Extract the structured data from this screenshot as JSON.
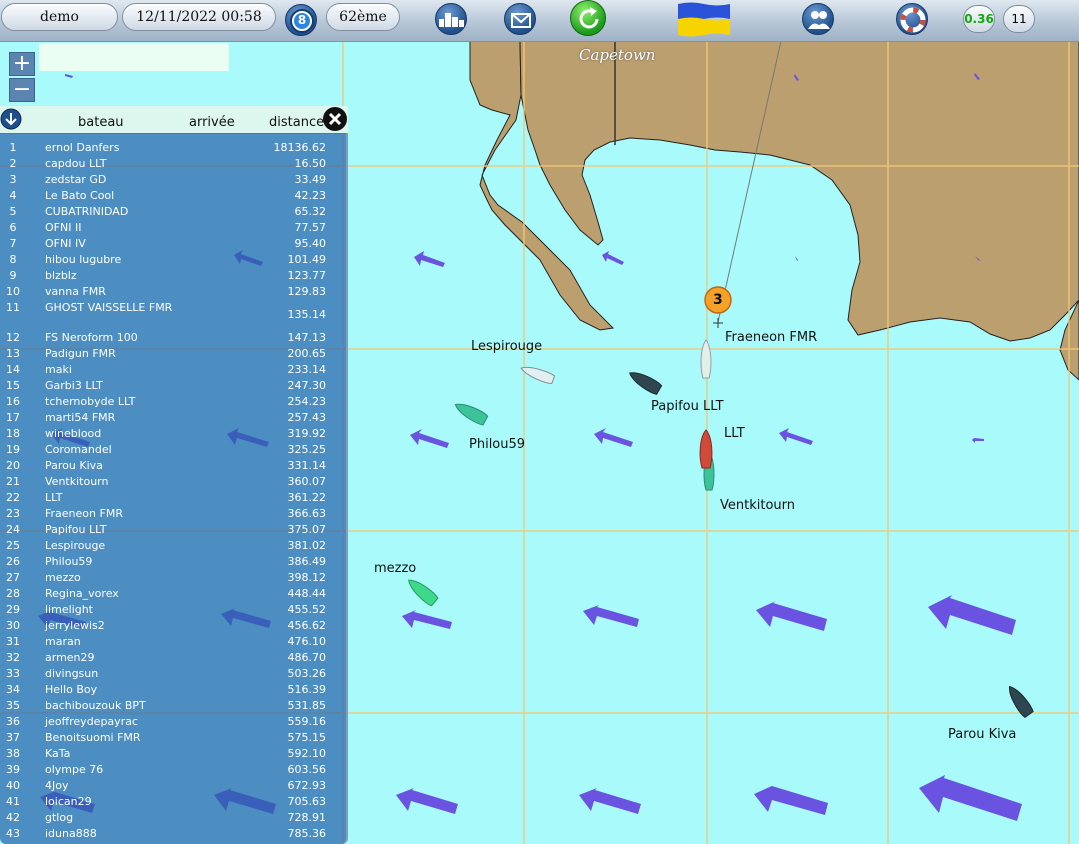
{
  "toolbar": {
    "user": "demo",
    "datetime": "12/11/2022 00:58",
    "clock_badge": "8",
    "rank": "62ème",
    "score_left": "0.36",
    "score_right": "11"
  },
  "map": {
    "city": "Capetown",
    "waypoint_number": "3",
    "boat_labels": [
      "Lespirouge",
      "Fraeneon FMR",
      "Papifou LLT",
      "Philou59",
      "LLT",
      "Ventkitourn",
      "mezzo",
      "Parou Kiva"
    ]
  },
  "ranking": {
    "col_boat": "bateau",
    "col_arrival": "arrivée",
    "col_distance": "distance",
    "rows": [
      {
        "n": "1",
        "name": "ernol Danfers",
        "dist": "18136.62"
      },
      {
        "n": "2",
        "name": "capdou LLT",
        "dist": "16.50"
      },
      {
        "n": "3",
        "name": "zedstar GD",
        "dist": "33.49"
      },
      {
        "n": "4",
        "name": "Le Bato Cool",
        "dist": "42.23"
      },
      {
        "n": "5",
        "name": "CUBATRINIDAD",
        "dist": "65.32"
      },
      {
        "n": "6",
        "name": "OFNI II",
        "dist": "77.57"
      },
      {
        "n": "7",
        "name": "OFNI IV",
        "dist": "95.40"
      },
      {
        "n": "8",
        "name": "hibou lugubre",
        "dist": "101.49"
      },
      {
        "n": "9",
        "name": "blzblz",
        "dist": "123.77"
      },
      {
        "n": "10",
        "name": "vanna FMR",
        "dist": "129.83"
      },
      {
        "n": "11",
        "name": "GHOST VAISSELLE FMR",
        "dist": "135.14"
      },
      {
        "n": "12",
        "name": "FS Neroform 100",
        "dist": "147.13"
      },
      {
        "n": "13",
        "name": "Padigun FMR",
        "dist": "200.65"
      },
      {
        "n": "14",
        "name": "maki",
        "dist": "233.14"
      },
      {
        "n": "15",
        "name": "Garbi3 LLT",
        "dist": "247.30"
      },
      {
        "n": "16",
        "name": "tchernobyde LLT",
        "dist": "254.23"
      },
      {
        "n": "17",
        "name": "marti54 FMR",
        "dist": "257.43"
      },
      {
        "n": "18",
        "name": "wineblood",
        "dist": "319.92"
      },
      {
        "n": "19",
        "name": "Coromandel",
        "dist": "325.25"
      },
      {
        "n": "20",
        "name": "Parou Kiva",
        "dist": "331.14"
      },
      {
        "n": "21",
        "name": "Ventkitourn",
        "dist": "360.07"
      },
      {
        "n": "22",
        "name": "LLT",
        "dist": "361.22"
      },
      {
        "n": "23",
        "name": "Fraeneon FMR",
        "dist": "366.63"
      },
      {
        "n": "24",
        "name": "Papifou LLT",
        "dist": "375.07"
      },
      {
        "n": "25",
        "name": "Lespirouge",
        "dist": "381.02"
      },
      {
        "n": "26",
        "name": "Philou59",
        "dist": "386.49"
      },
      {
        "n": "27",
        "name": "mezzo",
        "dist": "398.12"
      },
      {
        "n": "28",
        "name": "Regina_vorex",
        "dist": "448.44"
      },
      {
        "n": "29",
        "name": "limelight",
        "dist": "455.52"
      },
      {
        "n": "30",
        "name": "jerrylewis2",
        "dist": "456.62"
      },
      {
        "n": "31",
        "name": "maran",
        "dist": "476.10"
      },
      {
        "n": "32",
        "name": "armen29",
        "dist": "486.70"
      },
      {
        "n": "33",
        "name": "divingsun",
        "dist": "503.26"
      },
      {
        "n": "34",
        "name": "Hello Boy",
        "dist": "516.39"
      },
      {
        "n": "35",
        "name": "bachibouzouk BPT",
        "dist": "531.85"
      },
      {
        "n": "36",
        "name": "jeoffreydepayrac",
        "dist": "559.16"
      },
      {
        "n": "37",
        "name": "Benoitsuomi FMR",
        "dist": "575.15"
      },
      {
        "n": "38",
        "name": "KaTa",
        "dist": "592.10"
      },
      {
        "n": "39",
        "name": "olympe 76",
        "dist": "603.56"
      },
      {
        "n": "40",
        "name": "4Joy",
        "dist": "672.93"
      },
      {
        "n": "41",
        "name": "loican29",
        "dist": "705.63"
      },
      {
        "n": "42",
        "name": "gtlog",
        "dist": "728.91"
      },
      {
        "n": "43",
        "name": "iduna888",
        "dist": "785.36"
      }
    ]
  },
  "icons": {
    "clock": "clock-icon",
    "ranking": "podium-icon",
    "mail": "mail-icon",
    "refresh": "refresh-icon",
    "flag": "ukraine-flag-icon",
    "team": "people-icon",
    "help": "lifebuoy-icon"
  },
  "colors": {
    "sea": "#a9fbfb",
    "land": "#bb9f6f",
    "wind_arrow": "#6a53e0",
    "panel": "#2b6aa8"
  }
}
